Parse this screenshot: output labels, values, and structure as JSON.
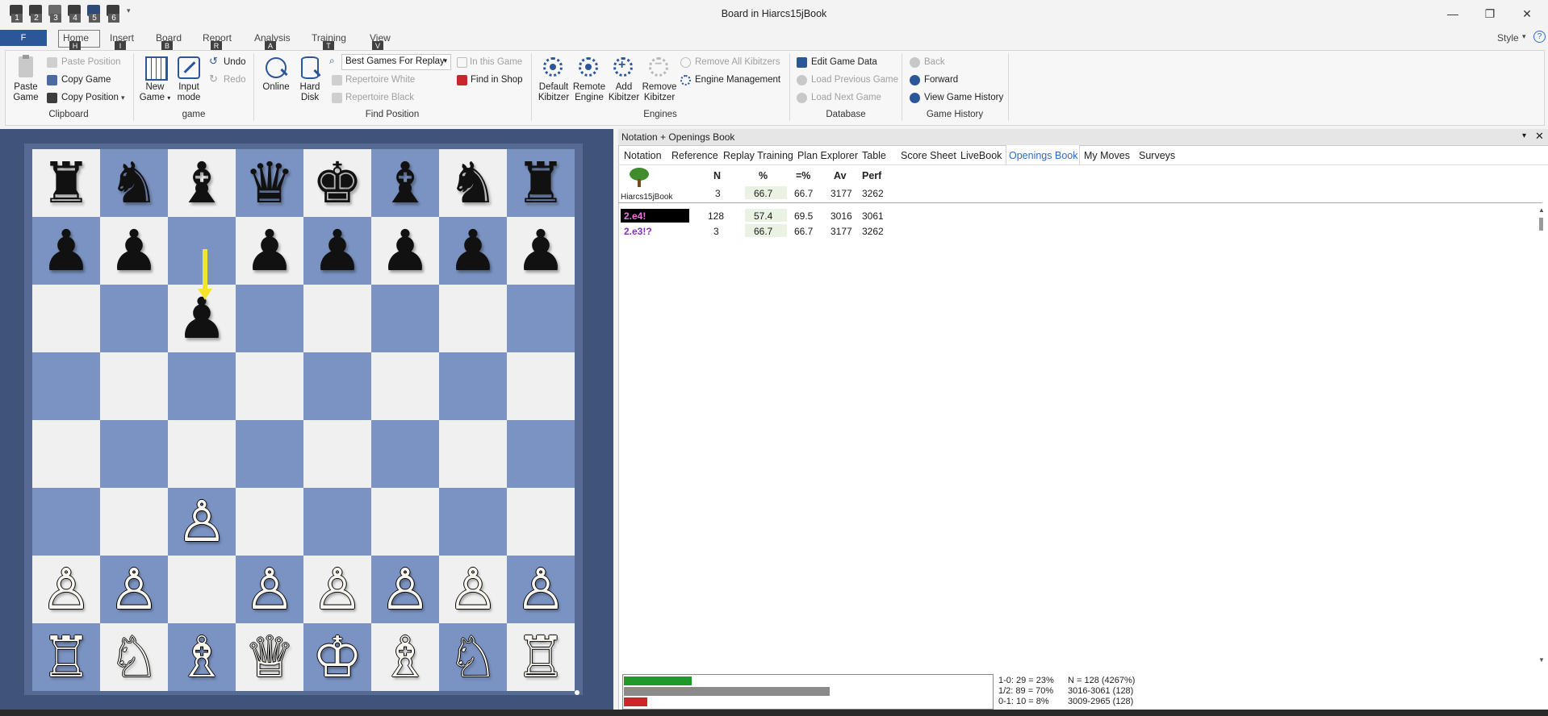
{
  "window": {
    "title": "Board in Hiarcs15jBook",
    "controls": [
      "—",
      "❐",
      "✕"
    ],
    "qat_numbers": [
      "1",
      "2",
      "3",
      "4",
      "5",
      "6"
    ]
  },
  "menu": {
    "file": "F",
    "tabs": [
      {
        "label": "Home",
        "key": "H"
      },
      {
        "label": "Insert",
        "key": "I"
      },
      {
        "label": "Board",
        "key": "B"
      },
      {
        "label": "Report",
        "key": "R"
      },
      {
        "label": "Analysis",
        "key": "A"
      },
      {
        "label": "Training",
        "key": "T"
      },
      {
        "label": "View",
        "key": "V"
      }
    ],
    "style": "Style"
  },
  "ribbon": {
    "clipboard": {
      "paste_game": [
        "Paste",
        "Game"
      ],
      "paste_position": "Paste Position",
      "copy_game": "Copy Game",
      "copy_position": "Copy Position",
      "undo": "Undo",
      "redo": "Redo",
      "label": "Clipboard"
    },
    "game": {
      "new_game": [
        "New",
        "Game"
      ],
      "input_mode": [
        "Input",
        "mode"
      ],
      "label": "game"
    },
    "find": {
      "online": "Online",
      "hard_disk": [
        "Hard",
        "Disk"
      ],
      "dropdown": "Best Games For Replay",
      "in_this_game": "In this Game",
      "find_in_shop": "Find in Shop",
      "repertoire_white": "Repertoire White",
      "repertoire_black": "Repertoire Black",
      "label": "Find Position"
    },
    "engines": {
      "default_kibitzer": [
        "Default",
        "Kibitzer"
      ],
      "remote_engine": [
        "Remote",
        "Engine"
      ],
      "add_kibitzer": [
        "Add",
        "Kibitzer"
      ],
      "remove_kibitzer": [
        "Remove",
        "Kibitzer"
      ],
      "remove_all_kibitzers": "Remove All Kibitzers",
      "engine_management": "Engine Management",
      "label": "Engines"
    },
    "database": {
      "edit_game_data": "Edit Game Data",
      "load_previous_game": "Load Previous Game",
      "load_next_game": "Load Next Game",
      "label": "Database"
    },
    "history": {
      "back": "Back",
      "forward": "Forward",
      "view_game_history": "View Game History",
      "label": "Game History"
    }
  },
  "board": {
    "rows": [
      [
        "♜",
        "♞",
        "♝",
        "♛",
        "♚",
        "♝",
        "♞",
        "♜"
      ],
      [
        "♟",
        "♟",
        "",
        "♟",
        "♟",
        "♟",
        "♟",
        "♟"
      ],
      [
        "",
        "",
        "♟",
        "",
        "",
        "",
        "",
        ""
      ],
      [
        "",
        "",
        "",
        "",
        "",
        "",
        "",
        ""
      ],
      [
        "",
        "",
        "",
        "",
        "",
        "",
        "",
        ""
      ],
      [
        "",
        "",
        "♙",
        "",
        "",
        "",
        "",
        ""
      ],
      [
        "♙",
        "♙",
        "",
        "♙",
        "♙",
        "♙",
        "♙",
        "♙"
      ],
      [
        "♖",
        "♘",
        "♗",
        "♕",
        "♔",
        "♗",
        "♘",
        "♖"
      ]
    ],
    "colors": {
      "light": "#f0f0f0",
      "dark": "#7b93c2",
      "arrow": "#f5e52a"
    }
  },
  "panel": {
    "title": "Notation + Openings Book",
    "tabs": [
      "Notation",
      "Reference",
      "Replay Training",
      "Plan Explorer",
      "Table",
      "Score Sheet",
      "LiveBook",
      "Openings Book",
      "My Moves",
      "Surveys"
    ],
    "active_tab": "Openings Book",
    "book": {
      "name": "Hiarcs15jBook",
      "headers": {
        "n": "N",
        "pct": "%",
        "draw": "=%",
        "av": "Av",
        "perf": "Perf"
      },
      "summary": {
        "n": "3",
        "pct": "66.7",
        "draw": "66.7",
        "av": "3177",
        "perf": "3262"
      },
      "moves": [
        {
          "move": "2.e4!",
          "n": "128",
          "pct": "57.4",
          "draw": "69.5",
          "av": "3016",
          "perf": "3061",
          "selected": true
        },
        {
          "move": "2.e3!?",
          "n": "3",
          "pct": "66.7",
          "draw": "66.7",
          "av": "3177",
          "perf": "3262",
          "selected": false
        }
      ]
    },
    "stats": {
      "win": "1-0:  29 = 23%",
      "draw": "1/2:  89 = 70%",
      "loss": "0-1:  10 = 8%",
      "n": "N = 128 (4267%)",
      "range1": "3016-3061 (128)",
      "range2": "3009-2965 (128)",
      "win_frac": 0.23,
      "draw_frac": 0.7,
      "loss_frac": 0.08
    }
  }
}
